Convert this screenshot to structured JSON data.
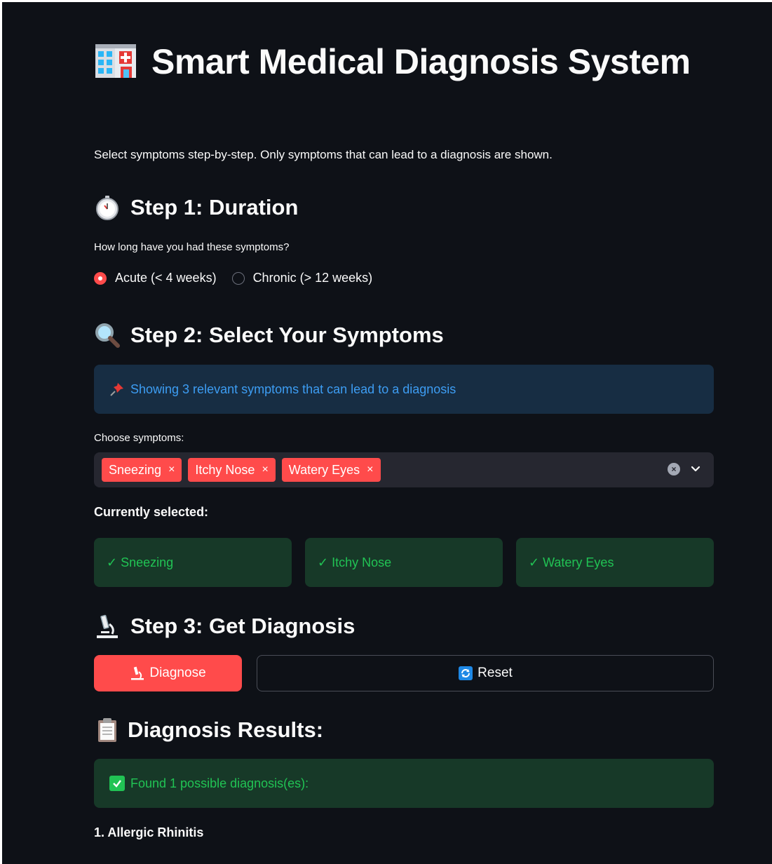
{
  "header": {
    "title": "Smart Medical Diagnosis System",
    "subtitle": "Select symptoms step-by-step. Only symptoms that can lead to a diagnosis are shown.",
    "icon": "hospital-icon"
  },
  "step1": {
    "heading": "Step 1: Duration",
    "icon": "stopwatch-icon",
    "question": "How long have you had these symptoms?",
    "options": [
      {
        "label": "Acute (< 4 weeks)",
        "selected": true
      },
      {
        "label": "Chronic (> 12 weeks)",
        "selected": false
      }
    ]
  },
  "step2": {
    "heading": "Step 2: Select Your Symptoms",
    "icon": "magnifier-icon",
    "info": "Showing 3 relevant symptoms that can lead to a diagnosis",
    "info_icon": "pushpin-icon",
    "choose_label": "Choose symptoms:",
    "selected_tags": [
      "Sneezing",
      "Itchy Nose",
      "Watery Eyes"
    ],
    "tag_remove_glyph": "×",
    "currently_selected_label": "Currently selected:",
    "currently_selected": [
      "✓ Sneezing",
      "✓ Itchy Nose",
      "✓ Watery Eyes"
    ]
  },
  "step3": {
    "heading": "Step 3: Get Diagnosis",
    "icon": "microscope-icon",
    "diagnose_label": "Diagnose",
    "reset_label": "Reset"
  },
  "results": {
    "heading": "Diagnosis Results:",
    "icon": "clipboard-icon",
    "success": "Found 1 possible diagnosis(es):",
    "items": [
      "1. Allergic Rhinitis"
    ]
  },
  "colors": {
    "background": "#0e1117",
    "primary": "#ff4b4b",
    "info_bg": "#172d43",
    "info_text": "#3d9df3",
    "success_bg": "#173928",
    "success_text": "#21c354",
    "input_bg": "#262730"
  }
}
